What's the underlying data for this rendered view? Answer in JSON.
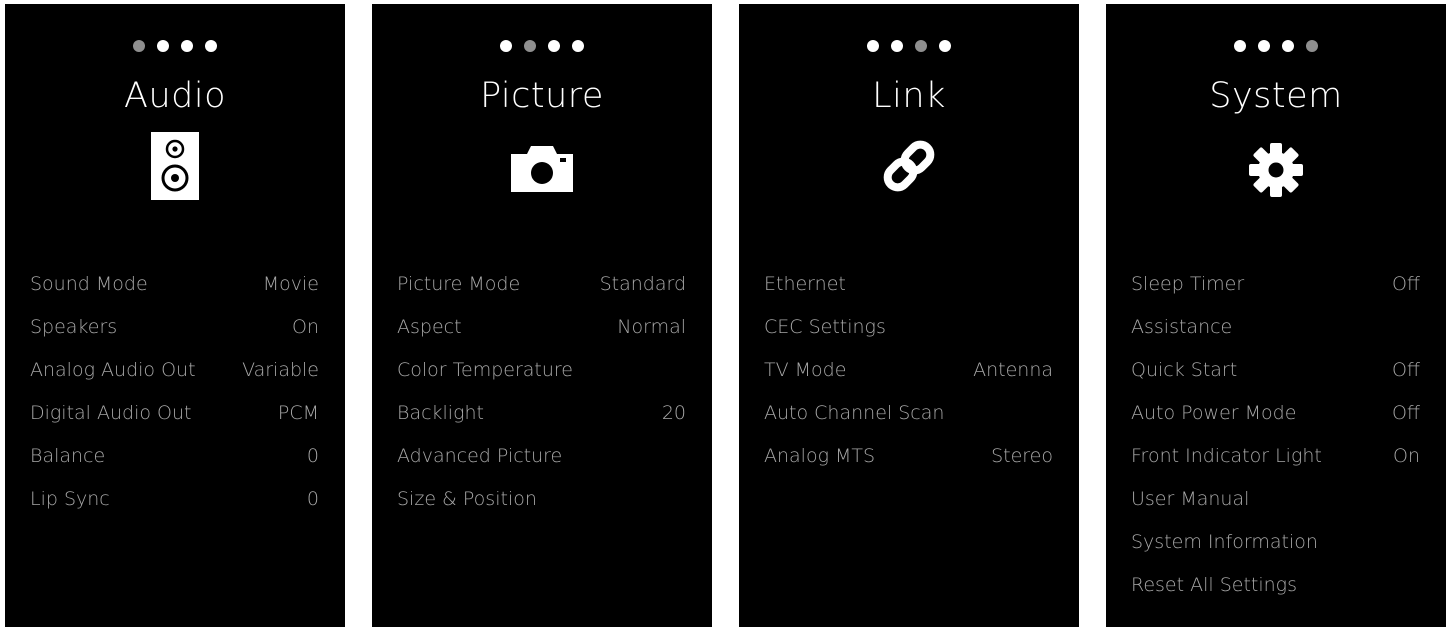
{
  "panels": [
    {
      "title": "Audio",
      "icon": "speaker-icon",
      "active_dot": 0,
      "items": [
        {
          "label": "Sound Mode",
          "value": "Movie"
        },
        {
          "label": "Speakers",
          "value": "On"
        },
        {
          "label": "Analog Audio Out",
          "value": "Variable"
        },
        {
          "label": "Digital Audio Out",
          "value": "PCM"
        },
        {
          "label": "Balance",
          "value": "0"
        },
        {
          "label": "Lip Sync",
          "value": "0"
        }
      ]
    },
    {
      "title": "Picture",
      "icon": "camera-icon",
      "active_dot": 1,
      "items": [
        {
          "label": "Picture Mode",
          "value": "Standard"
        },
        {
          "label": "Aspect",
          "value": "Normal"
        },
        {
          "label": "Color Temperature",
          "value": ""
        },
        {
          "label": "Backlight",
          "value": "20"
        },
        {
          "label": "Advanced Picture",
          "value": ""
        },
        {
          "label": "Size & Position",
          "value": ""
        }
      ]
    },
    {
      "title": "Link",
      "icon": "link-icon",
      "active_dot": 2,
      "items": [
        {
          "label": "Ethernet",
          "value": ""
        },
        {
          "label": "CEC Settings",
          "value": ""
        },
        {
          "label": "TV Mode",
          "value": "Antenna"
        },
        {
          "label": "Auto Channel Scan",
          "value": ""
        },
        {
          "label": "Analog MTS",
          "value": "Stereo"
        }
      ]
    },
    {
      "title": "System",
      "icon": "gear-icon",
      "active_dot": 3,
      "items": [
        {
          "label": "Sleep Timer",
          "value": "Off"
        },
        {
          "label": "Assistance",
          "value": ""
        },
        {
          "label": "Quick Start",
          "value": "Off"
        },
        {
          "label": "Auto Power Mode",
          "value": "Off"
        },
        {
          "label": "Front Indicator Light",
          "value": "On"
        },
        {
          "label": "User Manual",
          "value": ""
        },
        {
          "label": "System Information",
          "value": ""
        },
        {
          "label": "Reset All Settings",
          "value": ""
        }
      ]
    }
  ],
  "colors": {
    "background": "#000000",
    "title": "#ffffff",
    "item_text": "#a8a8a8",
    "dot": "#ffffff",
    "dot_active": "#8f8f8f"
  }
}
